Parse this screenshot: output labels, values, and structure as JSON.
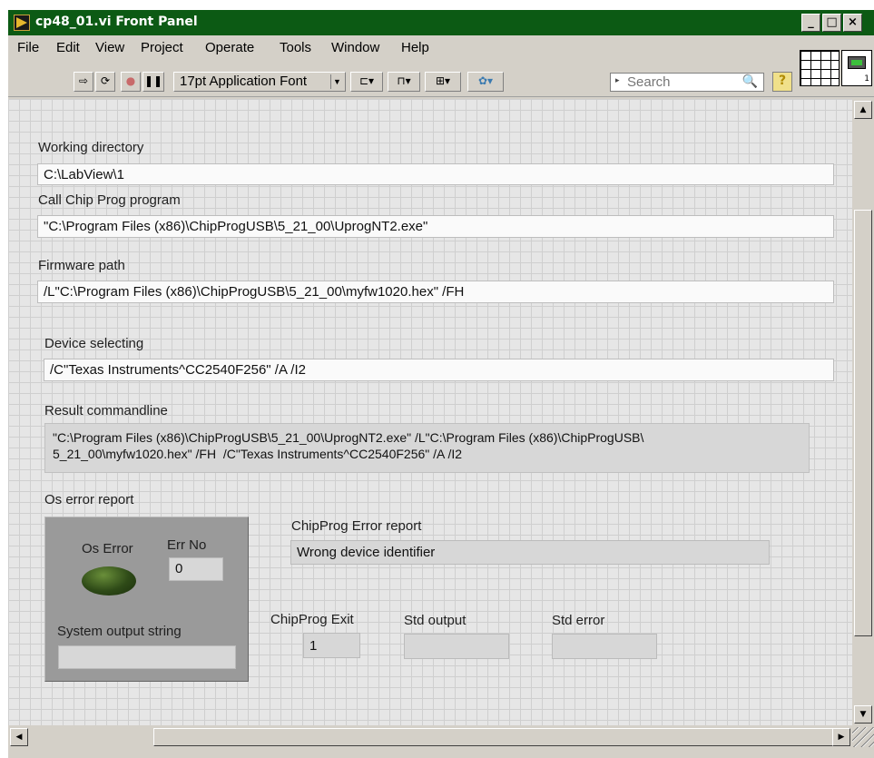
{
  "window": {
    "title": "cp48_01.vi Front Panel",
    "controls": {
      "minimize": "_",
      "maximize": "□",
      "close": "×"
    }
  },
  "menu": [
    "File",
    "Edit",
    "View",
    "Project",
    "Operate",
    "Tools",
    "Window",
    "Help"
  ],
  "toolbar": {
    "font": "17pt Application Font",
    "search_placeholder": "Search",
    "icons": [
      "run-arrow-icon",
      "run-continuously-icon",
      "abort-icon",
      "pause-icon",
      "align-icon",
      "distribute-icon",
      "resize-icon",
      "reorder-icon",
      "help-icon"
    ]
  },
  "panel": {
    "working_directory": {
      "label": "Working directory",
      "value": "C:\\LabView\\1"
    },
    "call_chip_prog": {
      "label": "Call Chip Prog program",
      "value": "\"C:\\Program Files (x86)\\ChipProgUSB\\5_21_00\\UprogNT2.exe\""
    },
    "firmware_path": {
      "label": "Firmware path",
      "value": "/L\"C:\\Program Files (x86)\\ChipProgUSB\\5_21_00\\myfw1020.hex\" /FH"
    },
    "device_selecting": {
      "label": "Device selecting",
      "value": " /C\"Texas Instruments^CC2540F256\" /A /I2"
    },
    "result_commandline": {
      "label": "Result commandline",
      "value": "\"C:\\Program Files (x86)\\ChipProgUSB\\5_21_00\\UprogNT2.exe\" /L\"C:\\Program Files (x86)\\ChipProgUSB\\\n5_21_00\\myfw1020.hex\" /FH  /C\"Texas Instruments^CC2540F256\" /A /I2"
    },
    "os_error_report": {
      "label": "Os error report",
      "os_error_label": "Os Error",
      "err_no_label": "Err No",
      "err_no_value": "0",
      "system_output_label": "System output string",
      "system_output_value": "",
      "led_color": "#2e4a17"
    },
    "chipprog_error_report": {
      "label": "ChipProg Error report",
      "value": "Wrong device identifier"
    },
    "chipprog_exit": {
      "label": "ChipProg Exit",
      "value": "1"
    },
    "std_output": {
      "label": "Std output",
      "value": ""
    },
    "std_error": {
      "label": "Std error",
      "value": ""
    }
  },
  "colors": {
    "titlebar": "#0c5a14",
    "chrome": "#d4d0c8",
    "panel_bg": "#e6e6e6"
  }
}
